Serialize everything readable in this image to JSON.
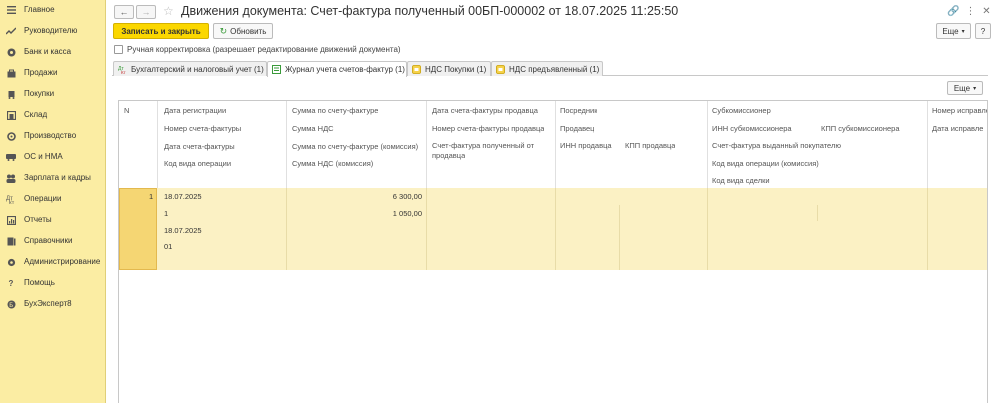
{
  "sidebar": {
    "items": [
      {
        "label": "Главное",
        "icon": "menu-icon"
      },
      {
        "label": "Руководителю",
        "icon": "chart-trend-icon"
      },
      {
        "label": "Банк и касса",
        "icon": "bank-icon"
      },
      {
        "label": "Продажи",
        "icon": "sales-bag-icon"
      },
      {
        "label": "Покупки",
        "icon": "shopping-cart-icon"
      },
      {
        "label": "Склад",
        "icon": "warehouse-icon"
      },
      {
        "label": "Производство",
        "icon": "factory-icon"
      },
      {
        "label": "ОС и НМА",
        "icon": "assets-icon"
      },
      {
        "label": "Зарплата и кадры",
        "icon": "people-icon"
      },
      {
        "label": "Операции",
        "icon": "operations-icon"
      },
      {
        "label": "Отчеты",
        "icon": "reports-icon"
      },
      {
        "label": "Справочники",
        "icon": "catalogs-icon"
      },
      {
        "label": "Администрирование",
        "icon": "admin-gear-icon"
      },
      {
        "label": "Помощь",
        "icon": "help-icon"
      },
      {
        "label": "БухЭксперт8",
        "icon": "expert-icon"
      }
    ]
  },
  "header": {
    "title": "Движения документа: Счет-фактура полученный 00БП-000002 от 18.07.2025 11:25:50"
  },
  "toolbar": {
    "save_close_label": "Записать и закрыть",
    "refresh_label": "Обновить",
    "more_label": "Еще",
    "help_label": "?"
  },
  "manual_correction": {
    "label": "Ручная корректировка (разрешает редактирование движений документа)",
    "checked": false
  },
  "tabs": [
    {
      "label": "Бухгалтерский и налоговый учет (1)",
      "active": false
    },
    {
      "label": "Журнал учета счетов-фактур (1)",
      "active": true
    },
    {
      "label": "НДС Покупки (1)",
      "active": false
    },
    {
      "label": "НДС предъявленный (1)",
      "active": false
    }
  ],
  "table": {
    "more_label": "Еще",
    "columns": {
      "n": "N",
      "c1": [
        "Дата регистрации",
        "Номер счета-фактуры",
        "Дата счета-фактуры",
        "Код вида операции"
      ],
      "c2": [
        "Сумма по счету-фактуре",
        "Сумма НДС",
        "Сумма по счету-фактуре (комиссия)",
        "Сумма НДС (комиссия)"
      ],
      "c3": [
        "Дата счета-фактуры продавца",
        "Номер счета-фактуры продавца",
        "Счет-фактура полученный от",
        "продавца"
      ],
      "c4": [
        "Посредник",
        "Продавец"
      ],
      "c4a": "ИНН продавца",
      "c4b": "КПП продавца",
      "c5": [
        "Субкомиссионер",
        "Счет-фактура выданный покупателю",
        "Код вида операции (комиссия)",
        "Код вида сделки"
      ],
      "c5a": "ИНН субкомиссионера",
      "c5b": "КПП субкомиссионера",
      "c6": [
        "Номер исправле",
        "Дата исправле"
      ]
    },
    "row": {
      "n": "1",
      "date_reg": "18.07.2025",
      "invoice_no": "1",
      "invoice_date": "18.07.2025",
      "op_code": "01",
      "amount": "6 300,00",
      "vat": "1 050,00"
    }
  }
}
